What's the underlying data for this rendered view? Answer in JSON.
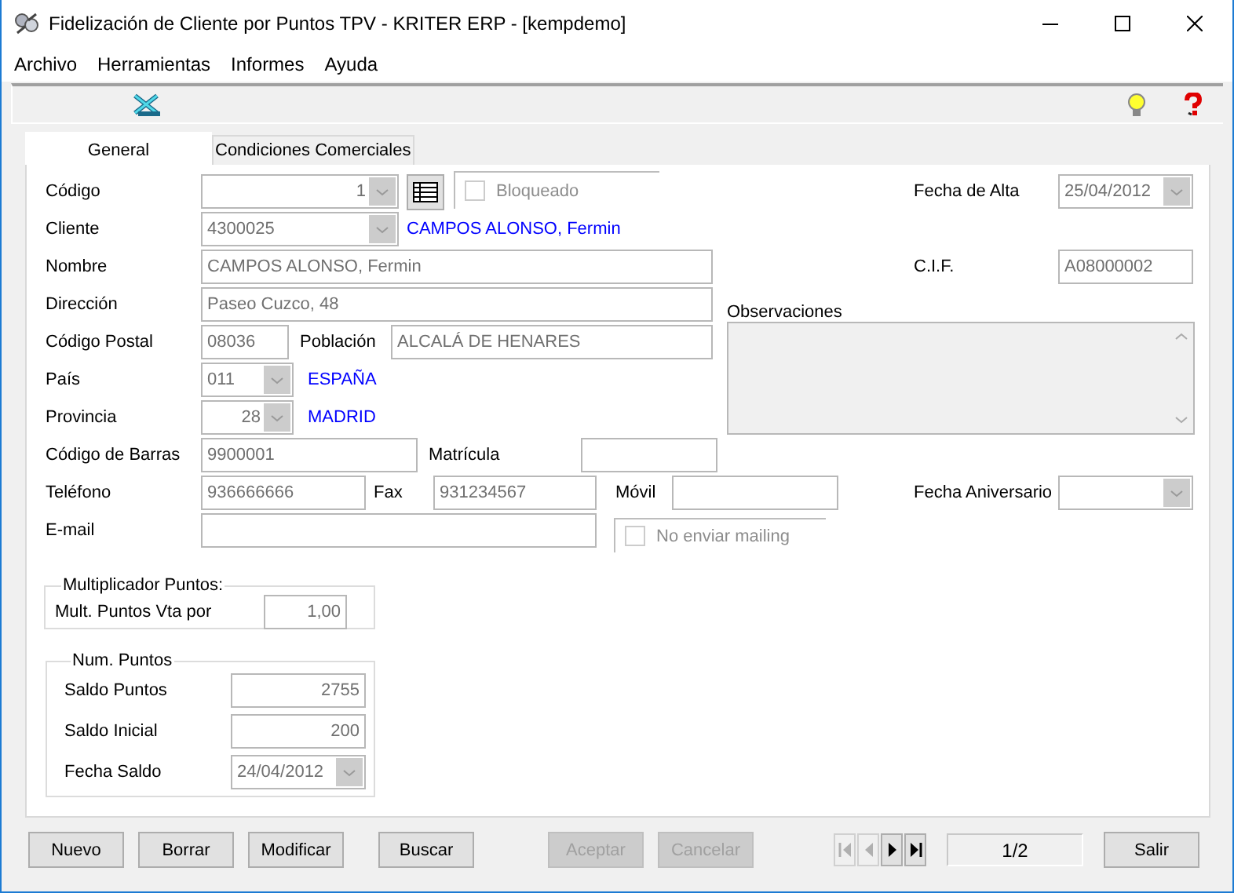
{
  "window": {
    "title": "Fidelización de Cliente por Puntos TPV - KRITER ERP - [kempdemo]"
  },
  "menu": [
    "Archivo",
    "Herramientas",
    "Informes",
    "Ayuda"
  ],
  "tabs": [
    {
      "label": "General",
      "selected": true
    },
    {
      "label": "Condiciones Comerciales",
      "selected": false
    }
  ],
  "general": {
    "codigo": {
      "label": "Código",
      "value": "1"
    },
    "bloqueado": {
      "label": "Bloqueado",
      "checked": false,
      "disabled": true
    },
    "fecha_alta": {
      "label": "Fecha de Alta",
      "value": "25/04/2012"
    },
    "cliente": {
      "label": "Cliente",
      "value": "4300025",
      "name": "CAMPOS ALONSO, Fermin"
    },
    "nombre": {
      "label": "Nombre",
      "value": "CAMPOS ALONSO, Fermin"
    },
    "cif": {
      "label": "C.I.F.",
      "value": "A08000002"
    },
    "direccion": {
      "label": "Dirección",
      "value": "Paseo Cuzco, 48"
    },
    "observaciones": {
      "label": "Observaciones"
    },
    "codigo_postal": {
      "label": "Código Postal",
      "value": "08036"
    },
    "poblacion": {
      "label": "Población",
      "value": "ALCALÁ DE HENARES"
    },
    "pais": {
      "label": "País",
      "value": "011",
      "name": "ESPAÑA"
    },
    "provincia": {
      "label": "Provincia",
      "value": "28",
      "name": "MADRID"
    },
    "codigo_barras": {
      "label": "Código de Barras",
      "value": "9900001"
    },
    "matricula": {
      "label": "Matrícula"
    },
    "telefono": {
      "label": "Teléfono",
      "value": "936666666"
    },
    "fax": {
      "label": "Fax",
      "value": "931234567"
    },
    "movil": {
      "label": "Móvil"
    },
    "fecha_aniversario": {
      "label": "Fecha Aniversario"
    },
    "email": {
      "label": "E-mail"
    },
    "no_enviar_mailing": {
      "label": "No enviar mailing",
      "checked": false,
      "disabled": true
    }
  },
  "multiplicador": {
    "title": "Multiplicador Puntos:",
    "label": "Mult. Puntos Vta por",
    "value": "1,00"
  },
  "num_puntos": {
    "title": "Num. Puntos",
    "rows": [
      {
        "label": "Saldo Puntos",
        "value": "2755",
        "kind": "number"
      },
      {
        "label": "Saldo Inicial",
        "value": "200",
        "kind": "number"
      },
      {
        "label": "Fecha Saldo",
        "value": "24/04/2012",
        "kind": "date"
      }
    ]
  },
  "buttons": [
    {
      "label": "Nuevo",
      "disabled": false
    },
    {
      "label": "Borrar",
      "disabled": false
    },
    {
      "label": "Modificar",
      "disabled": false
    },
    {
      "label": "Buscar",
      "disabled": false
    },
    {
      "label": "Aceptar",
      "disabled": true
    },
    {
      "label": "Cancelar",
      "disabled": true
    }
  ],
  "navigator": {
    "buttons": [
      {
        "kind": "first",
        "disabled": true
      },
      {
        "kind": "previous",
        "disabled": true
      },
      {
        "kind": "next",
        "disabled": false
      },
      {
        "kind": "last",
        "disabled": false
      }
    ],
    "position": "1/2"
  },
  "exit_button": {
    "label": "Salir",
    "disabled": false
  }
}
